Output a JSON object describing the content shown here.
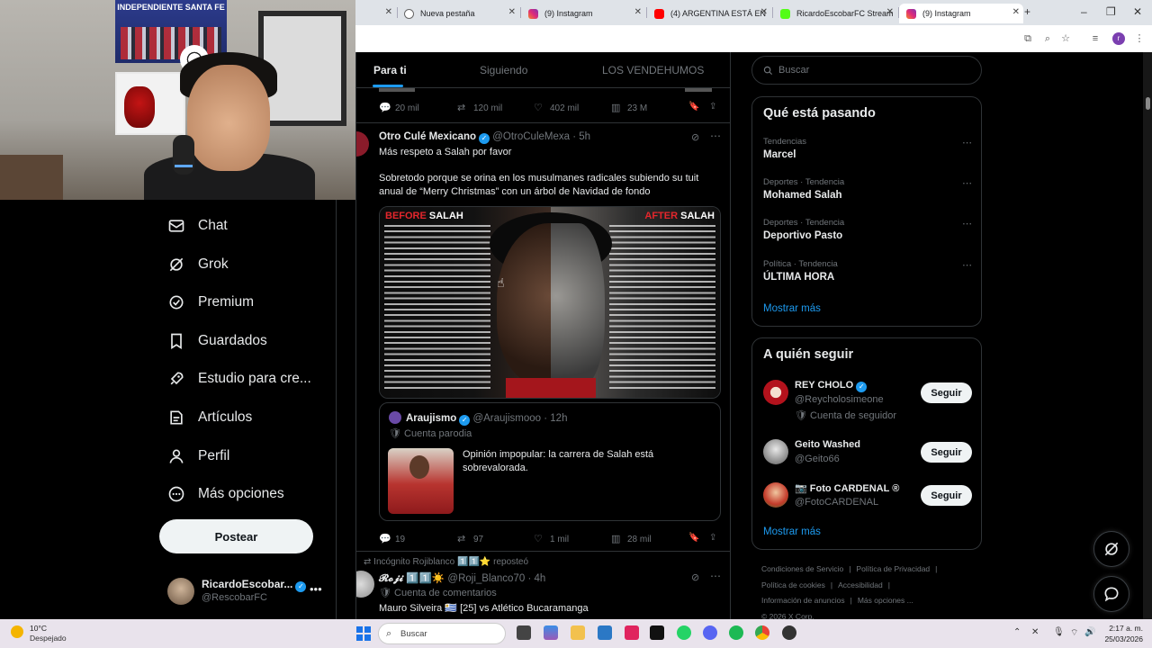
{
  "browser": {
    "tabs": [
      {
        "label": "",
        "active": false
      },
      {
        "label": "Nueva pestaña",
        "active": false
      },
      {
        "label": "(9) Instagram",
        "active": false
      },
      {
        "label": "(4) ARGENTINA ESTÁ EN",
        "active": false
      },
      {
        "label": "RicardoEscobarFC Stream",
        "active": false
      },
      {
        "label": "(9) Instagram",
        "active": true
      }
    ],
    "new_tab": "+",
    "window_controls": {
      "minimize": "–",
      "maximize": "❐",
      "close": "✕"
    },
    "profile_initial": "r"
  },
  "webcam": {
    "poster_text": "INDEPENDIENTE SANTA FE"
  },
  "nav": {
    "items": [
      {
        "label": "Chat",
        "icon": "mail-icon"
      },
      {
        "label": "Grok",
        "icon": "grok-icon"
      },
      {
        "label": "Premium",
        "icon": "premium-icon"
      },
      {
        "label": "Guardados",
        "icon": "bookmark-icon"
      },
      {
        "label": "Estudio para cre...",
        "icon": "rocket-icon"
      },
      {
        "label": "Artículos",
        "icon": "article-icon"
      },
      {
        "label": "Perfil",
        "icon": "person-icon"
      },
      {
        "label": "Más opciones",
        "icon": "more-circle-icon"
      }
    ],
    "post_button": "Postear",
    "me": {
      "name": "RicardoEscobar...",
      "handle": "@RescobarFC",
      "more": "•••"
    }
  },
  "feed": {
    "tabs": [
      "Para ti",
      "Siguiendo",
      "LOS VENDEHUMOS"
    ],
    "top_actions": {
      "replies": "20 mil",
      "reposts": "120 mil",
      "likes": "402 mil",
      "views": "23 M"
    },
    "post": {
      "author": "Otro Culé Mexicano",
      "handle": "@OtroCuleMexa",
      "time": "· 5h",
      "line1": "Más respeto a Salah por favor",
      "line2": "Sobretodo porque se orina en los musulmanes radicales subiendo su tuit anual de “Merry Christmas” con un árbol de Navidad de fondo",
      "image": {
        "before_a": "BEFORE",
        "before_b": " SALAH",
        "after_a": "AFTER",
        "after_b": " SALAH"
      },
      "quote": {
        "author": "Araujismo",
        "handle": "@Araujismooo",
        "time": "· 12h",
        "badge": "Cuenta parodia",
        "text": "Opinión impopular: la carrera de Salah está sobrevalorada."
      },
      "actions": {
        "replies": "19",
        "reposts": "97",
        "likes": "1 mil",
        "views": "28 mil"
      }
    },
    "next": {
      "repost_by": "Incógnito Rojiblanco 1️⃣1️⃣⭐ reposteó",
      "author": "𝓡𝓸𝓳𝓲 1️⃣1️⃣☀️",
      "handle": "@Roji_Blanco70",
      "time": "· 4h",
      "badge": "Cuenta de comentarios",
      "text": "Mauro Silveira 🇺🇾 [25] vs Atlético Bucaramanga"
    }
  },
  "right": {
    "search_placeholder": "Buscar",
    "trends_title": "Qué está pasando",
    "trends": [
      {
        "category": "Tendencias",
        "title": "Marcel"
      },
      {
        "category": "Deportes · Tendencia",
        "title": "Mohamed Salah"
      },
      {
        "category": "Deportes · Tendencia",
        "title": "Deportivo Pasto"
      },
      {
        "category": "Política · Tendencia",
        "title": "ÚLTIMA HORA"
      }
    ],
    "show_more": "Mostrar más",
    "who_title": "A quién seguir",
    "who": [
      {
        "name": "REY CHOLO",
        "handle": "@Reycholosimeone",
        "sub": "Cuenta de seguidor",
        "verified": true,
        "color": "#b3121c"
      },
      {
        "name": "Geito Washed",
        "handle": "@Geito66",
        "sub": "",
        "verified": false,
        "color": "#cfcfcf"
      },
      {
        "name": "📷 Foto CARDENAL ®",
        "handle": "@FotoCARDENAL",
        "sub": "",
        "verified": false,
        "color": "#c43a2a"
      }
    ],
    "follow_label": "Seguir",
    "show_more_2": "Mostrar más",
    "footer": [
      "Condiciones de Servicio",
      "|",
      "Política de Privacidad",
      "|",
      "Política de cookies",
      "|",
      "Accesibilidad",
      "|",
      "Información de anuncios",
      "|",
      "Más opciones ...",
      "© 2026 X Corp."
    ]
  },
  "taskbar": {
    "weather_temp": "10°C",
    "weather_desc": "Despejado",
    "search_label": "Buscar",
    "time": "2:17 a. m.",
    "date": "25/03/2026"
  }
}
